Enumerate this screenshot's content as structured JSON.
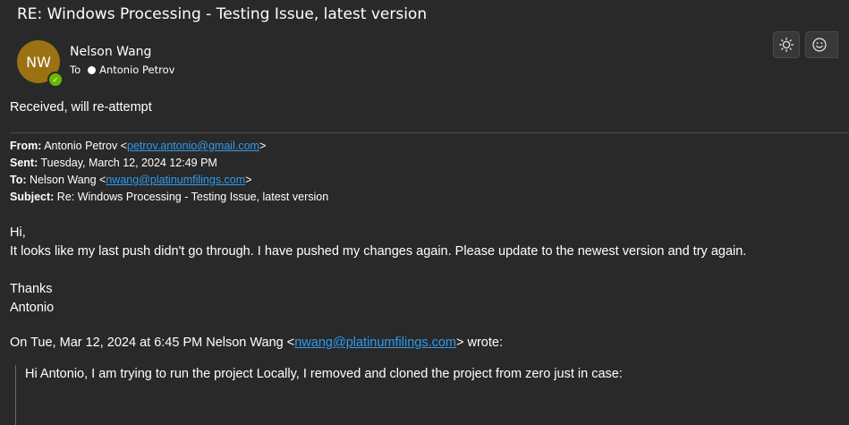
{
  "email": {
    "subject": "RE: Windows Processing - Testing Issue, latest version",
    "sender": {
      "initials": "NW",
      "name": "Nelson Wang",
      "presence_color": "#6bb700",
      "avatar_color": "#9a7212"
    },
    "to_label": "To",
    "recipient": "Antonio Petrov",
    "actions": {
      "brightness_icon": "sun-icon",
      "emoji_icon": "smiley-icon"
    },
    "reply_text": "Received, will re-attempt",
    "forward_header": {
      "from_label": "From:",
      "from_name": "Antonio Petrov <",
      "from_email": "petrov.antonio@gmail.com",
      "from_close": ">",
      "sent_label": "Sent:",
      "sent_value": "Tuesday, March 12, 2024 12:49 PM",
      "to_label": "To:",
      "to_name": "Nelson Wang <",
      "to_email": "nwang@platinumfilings.com",
      "to_close": ">",
      "subject_label": "Subject:",
      "subject_value": "Re: Windows Processing - Testing Issue, latest version"
    },
    "message": {
      "greeting": "Hi,",
      "line1": "It looks like my last push didn't go through. I have pushed my changes again. Please update to the newest version and try again.",
      "thanks": "Thanks",
      "signature": "Antonio"
    },
    "quote_intro": {
      "prefix": "On Tue, Mar 12, 2024 at 6:45 PM Nelson Wang <",
      "email": "nwang@platinumfilings.com",
      "suffix": "> wrote:"
    },
    "quote_text": "Hi Antonio, I am trying to run the project Locally, I removed and cloned the project from zero just in case:",
    "link_color": "#2e9bf0",
    "background_color": "#292929"
  }
}
